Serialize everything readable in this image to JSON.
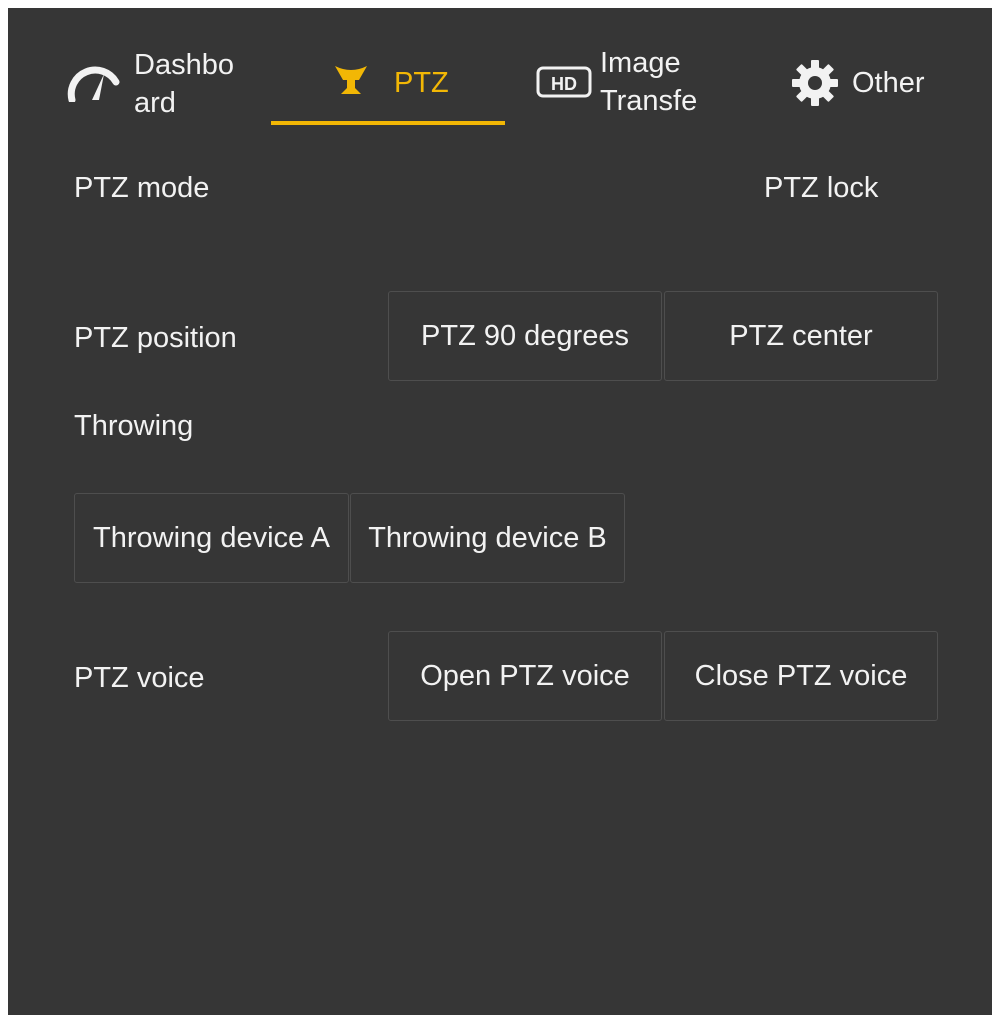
{
  "tabs": [
    {
      "label": "Dashbo\nard",
      "icon": "speedometer-icon"
    },
    {
      "label": "PTZ",
      "icon": "ptz-gimbal-icon",
      "active": true
    },
    {
      "label": "Image\nTransfe",
      "icon": "hd-icon"
    },
    {
      "label": "Other",
      "icon": "gear-icon"
    }
  ],
  "colors": {
    "accent": "#f2b705",
    "background": "#363636",
    "text": "#f2f2f2"
  },
  "ptz_mode": {
    "label": "PTZ mode",
    "lock_label": "PTZ lock"
  },
  "ptz_position": {
    "label": "PTZ position",
    "btn_90": "PTZ 90 degrees",
    "btn_center": "PTZ center"
  },
  "throwing": {
    "label": "Throwing",
    "btn_a": "Throwing device A",
    "btn_b": "Throwing device B"
  },
  "ptz_voice": {
    "label": "PTZ voice",
    "btn_open": "Open PTZ voice",
    "btn_close": "Close PTZ voice"
  }
}
